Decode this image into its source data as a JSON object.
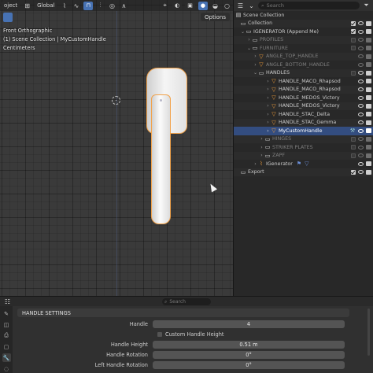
{
  "viewport": {
    "header": {
      "mode_label": "oject",
      "orientation": "Global"
    },
    "view_name": "Front Orthographic",
    "context_line": "(1) Scene Collection | MyCustomHandle",
    "units_line": "Centimeters",
    "options_label": "Options"
  },
  "outliner": {
    "search_placeholder": "Search",
    "rows": [
      {
        "label": "Scene Collection",
        "type": "collection"
      },
      {
        "label": "Collection",
        "type": "collection"
      },
      {
        "label": "IGENERATOR (Append Me)",
        "type": "collection"
      },
      {
        "label": "PROFILES",
        "type": "collection"
      },
      {
        "label": "FURNITURE",
        "type": "collection"
      },
      {
        "label": "ANGLE_TOP_HANDLE",
        "type": "object"
      },
      {
        "label": "ANGLE_BOTTOM_HANDLE",
        "type": "object"
      },
      {
        "label": "HANDLES",
        "type": "collection"
      },
      {
        "label": "HANDLE_MACO_Rhapsod",
        "type": "object"
      },
      {
        "label": "HANDLE_MACO_Rhapsod",
        "type": "object"
      },
      {
        "label": "HANDLE_MEDOS_Victory",
        "type": "object"
      },
      {
        "label": "HANDLE_MEDOS_Victory",
        "type": "object"
      },
      {
        "label": "HANDLE_STAC_Delta",
        "type": "object"
      },
      {
        "label": "HANDLE_STAC_Gemma",
        "type": "object"
      },
      {
        "label": "MyCustomHandle",
        "type": "object"
      },
      {
        "label": "HINGES",
        "type": "collection"
      },
      {
        "label": "STRIKER PLATES",
        "type": "collection"
      },
      {
        "label": "ZAPF",
        "type": "collection"
      },
      {
        "label": "IGenerator",
        "type": "object"
      },
      {
        "label": "Export",
        "type": "collection"
      }
    ]
  },
  "properties": {
    "search_placeholder": "Search",
    "section_title": "HANDLE SETTINGS",
    "handle_label": "Handle",
    "handle_value": "4",
    "custom_height_label": "Custom Handle Height",
    "height_label": "Handle Height",
    "height_value": "0.51 m",
    "rotation_label": "Handle Rotation",
    "rotation_value": "0°",
    "left_rotation_label": "Left Handle Rotation",
    "left_rotation_value": "0°"
  },
  "colors": {
    "selection": "#334d80",
    "object_orange": "#f29d3a",
    "accent_blue": "#4772b3"
  }
}
